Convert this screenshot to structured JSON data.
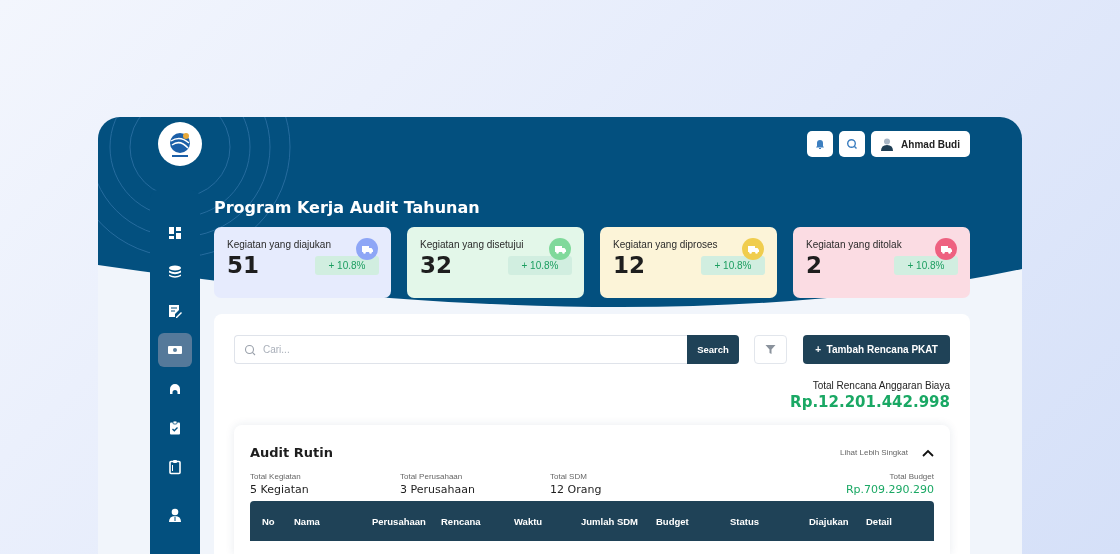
{
  "header": {
    "user_name": "Ahmad Budi"
  },
  "sidebar": {
    "items": [
      {
        "kind": "dashboard",
        "selected": false
      },
      {
        "kind": "database",
        "selected": false
      },
      {
        "kind": "edit",
        "selected": false
      },
      {
        "kind": "money",
        "selected": true
      },
      {
        "kind": "support",
        "selected": false
      },
      {
        "kind": "checklist",
        "selected": false
      },
      {
        "kind": "clipboard",
        "selected": false
      },
      {
        "kind": "profile",
        "selected": false
      }
    ]
  },
  "page_title": "Program Kerja Audit Tahunan",
  "stat_cards": [
    {
      "label": "Kegiatan yang diajukan",
      "value": "51",
      "change": "+ 10.8%",
      "color": "#8ea6f6"
    },
    {
      "label": "Kegiatan yang disetujui",
      "value": "32",
      "change": "+ 10.8%",
      "color": "#80d99b"
    },
    {
      "label": "Kegiatan yang diproses",
      "value": "12",
      "change": "+ 10.8%",
      "color": "#f0cd4e"
    },
    {
      "label": "Kegiatan yang ditolak",
      "value": "2",
      "change": "+ 10.8%",
      "color": "#ee6180"
    }
  ],
  "toolbar": {
    "search_placeholder": "Cari...",
    "search_button": "Search",
    "add_button": "+  Tambah Rencana PKAT"
  },
  "total_budget": {
    "label": "Total Rencana Anggaran Biaya",
    "value": "Rp.12.201.442.998"
  },
  "section": {
    "title": "Audit Rutin",
    "toggle_label": "Lihat Lebih Singkat",
    "expanded": true,
    "stats": [
      {
        "label": "Total Kegiatan",
        "value": "5 Kegiatan"
      },
      {
        "label": "Total Perusahaan",
        "value": "3 Perusahaan"
      },
      {
        "label": "Total SDM",
        "value": "12 Orang"
      },
      {
        "label": "Total Budget",
        "value": "Rp.709.290.290"
      }
    ],
    "table": {
      "columns": [
        "No",
        "Nama",
        "Perusahaan",
        "Rencana",
        "Waktu",
        "Jumlah SDM",
        "Budget",
        "Status",
        "Diajukan",
        "Detail"
      ]
    }
  }
}
